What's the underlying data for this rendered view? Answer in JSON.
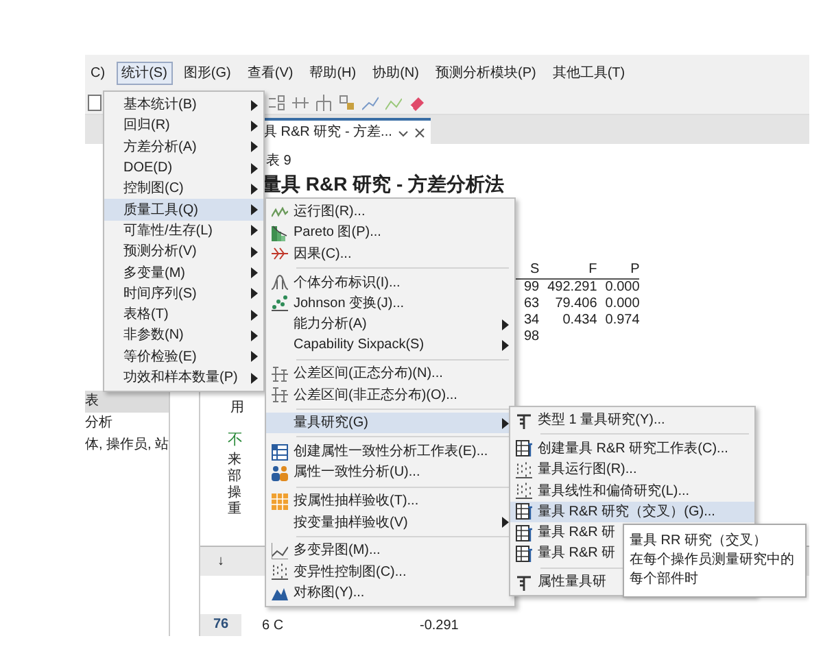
{
  "menu_bar": [
    {
      "label": "C)",
      "selected": false
    },
    {
      "label": "统计(S)",
      "selected": true
    },
    {
      "label": "图形(G)",
      "selected": false
    },
    {
      "label": "查看(V)",
      "selected": false
    },
    {
      "label": "帮助(H)",
      "selected": false
    },
    {
      "label": "协助(N)",
      "selected": false
    },
    {
      "label": "预测分析模块(P)",
      "selected": false
    },
    {
      "label": "其他工具(T)",
      "selected": false
    }
  ],
  "document_tab": {
    "title": "具 R&R 研究 - 方差..."
  },
  "navigator": {
    "items": [
      {
        "label": "表",
        "selected": true
      },
      {
        "label": "分析",
        "selected": false
      },
      {
        "label": "体, 操作员, 站",
        "selected": false
      }
    ]
  },
  "output": {
    "table_label": "表 9",
    "title": "量具 R&R 研究 - 方差分析法",
    "anova_table": {
      "columns": [
        "S",
        "F",
        "P"
      ],
      "rows": [
        [
          "99",
          "492.291",
          "0.000"
        ],
        [
          "63",
          "79.406",
          "0.000"
        ],
        [
          "34",
          "0.434",
          "0.974"
        ],
        [
          "98"
        ]
      ]
    },
    "note": "用",
    "section_title": "不",
    "row_labels": [
      "来",
      "部",
      "操",
      "重"
    ]
  },
  "worksheet": {
    "header": "↓",
    "rows": [
      {
        "row_number": "76",
        "cells": [
          "6 C",
          "-0.291"
        ]
      }
    ]
  },
  "stat_menu": {
    "items": [
      {
        "kind": "item",
        "label": "基本统计(B)",
        "submenu": true,
        "selected": false
      },
      {
        "kind": "item",
        "label": "回归(R)",
        "submenu": true,
        "selected": false
      },
      {
        "kind": "item",
        "label": "方差分析(A)",
        "submenu": true,
        "selected": false
      },
      {
        "kind": "item",
        "label": "DOE(D)",
        "submenu": true,
        "selected": false
      },
      {
        "kind": "item",
        "label": "控制图(C)",
        "submenu": true,
        "selected": false
      },
      {
        "kind": "item",
        "label": "质量工具(Q)",
        "submenu": true,
        "selected": true
      },
      {
        "kind": "item",
        "label": "可靠性/生存(L)",
        "submenu": true,
        "selected": false
      },
      {
        "kind": "item",
        "label": "预测分析(V)",
        "submenu": true,
        "selected": false
      },
      {
        "kind": "item",
        "label": "多变量(M)",
        "submenu": true,
        "selected": false
      },
      {
        "kind": "item",
        "label": "时间序列(S)",
        "submenu": true,
        "selected": false
      },
      {
        "kind": "item",
        "label": "表格(T)",
        "submenu": true,
        "selected": false
      },
      {
        "kind": "item",
        "label": "非参数(N)",
        "submenu": true,
        "selected": false
      },
      {
        "kind": "item",
        "label": "等价检验(E)",
        "submenu": true,
        "selected": false
      },
      {
        "kind": "item",
        "label": "功效和样本数量(P)",
        "submenu": true,
        "selected": false
      }
    ]
  },
  "quality_tools_menu": {
    "items": [
      {
        "kind": "item",
        "label": "运行图(R)...",
        "submenu": false,
        "selected": false
      },
      {
        "kind": "item",
        "label": "Pareto 图(P)...",
        "submenu": false,
        "selected": false
      },
      {
        "kind": "item",
        "label": "因果(C)...",
        "submenu": false,
        "selected": false
      },
      {
        "kind": "separator"
      },
      {
        "kind": "item",
        "label": "个体分布标识(I)...",
        "submenu": false,
        "selected": false
      },
      {
        "kind": "item",
        "label": "Johnson 变换(J)...",
        "submenu": false,
        "selected": false
      },
      {
        "kind": "item",
        "label": "能力分析(A)",
        "submenu": true,
        "selected": false
      },
      {
        "kind": "item",
        "label": "Capability Sixpack(S)",
        "submenu": true,
        "selected": false
      },
      {
        "kind": "separator"
      },
      {
        "kind": "item",
        "label": "公差区间(正态分布)(N)...",
        "submenu": false,
        "selected": false
      },
      {
        "kind": "item",
        "label": "公差区间(非正态分布)(O)...",
        "submenu": false,
        "selected": false
      },
      {
        "kind": "separator"
      },
      {
        "kind": "item",
        "label": "量具研究(G)",
        "submenu": true,
        "selected": true
      },
      {
        "kind": "separator"
      },
      {
        "kind": "item",
        "label": "创建属性一致性分析工作表(E)...",
        "submenu": false,
        "selected": false
      },
      {
        "kind": "item",
        "label": "属性一致性分析(U)...",
        "submenu": false,
        "selected": false
      },
      {
        "kind": "separator"
      },
      {
        "kind": "item",
        "label": "按属性抽样验收(T)...",
        "submenu": false,
        "selected": false
      },
      {
        "kind": "item",
        "label": "按变量抽样验收(V)",
        "submenu": true,
        "selected": false
      },
      {
        "kind": "separator"
      },
      {
        "kind": "item",
        "label": "多变异图(M)...",
        "submenu": false,
        "selected": false
      },
      {
        "kind": "item",
        "label": "变异性控制图(C)...",
        "submenu": false,
        "selected": false
      },
      {
        "kind": "item",
        "label": "对称图(Y)...",
        "submenu": false,
        "selected": false
      }
    ]
  },
  "gage_study_menu": {
    "items": [
      {
        "kind": "item",
        "label": "类型 1 量具研究(Y)...",
        "submenu": false,
        "selected": false
      },
      {
        "kind": "separator"
      },
      {
        "kind": "item",
        "label": "创建量具 R&R 研究工作表(C)...",
        "submenu": false,
        "selected": false
      },
      {
        "kind": "item",
        "label": "量具运行图(R)...",
        "submenu": false,
        "selected": false
      },
      {
        "kind": "item",
        "label": "量具线性和偏倚研究(L)...",
        "submenu": false,
        "selected": false
      },
      {
        "kind": "item",
        "label": "量具 R&R 研究（交叉）(G)...",
        "submenu": false,
        "selected": true
      },
      {
        "kind": "item",
        "label": "量具 R&R 研",
        "submenu": false,
        "selected": false
      },
      {
        "kind": "item",
        "label": "量具 R&R 研",
        "submenu": false,
        "selected": false
      },
      {
        "kind": "separator"
      },
      {
        "kind": "item",
        "label": "属性量具研",
        "submenu": false,
        "selected": false
      }
    ]
  },
  "tooltip": {
    "title": "量具 RR 研究（交叉）",
    "text": "在每个操作员测量研究中的每个部件时"
  }
}
